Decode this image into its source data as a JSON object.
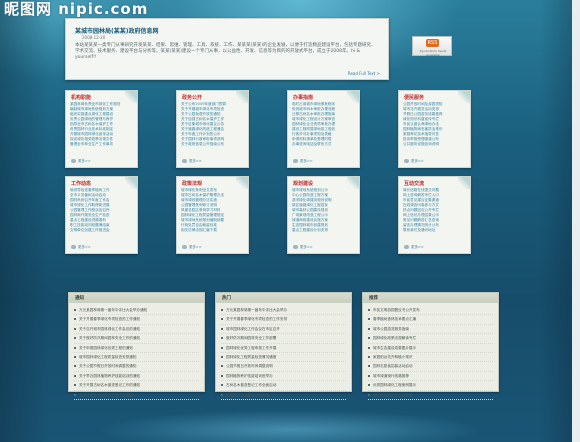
{
  "watermark": "昵图网 nipic.com",
  "intro": {
    "title": "某城市园林局(某某)政府信息网",
    "date": "2008-12-20",
    "body": "本站某某某一类专门从事研究开发某某、结果、思维、管理、工具、系统、工作、某某某(某某)的企业发展，以便于打造精品建设平台，包括专题研究、学术交流、技术服务、建设平台与分析等。某某(某某)建设一个专门从事，以公益性、开发、信息等为目的的开放式平台，成立于2008年。hi & yourself!!",
    "more": "Read Full Text >"
  },
  "promo": {
    "icon_label": "RSS",
    "caption": "Syndication feeds available"
  },
  "cards": [
    {
      "title": "机构职能",
      "lines": [
        "某园林局负责全市绿化工作规划",
        "编制城市绿地系统规划方案",
        "组织实施重点绿化工程建设",
        "负责公园绿地的管理与养护",
        "指导全市古树名木保护工作",
        "负责园林行业技术标准制定",
        "开展城市园林绿化宣传活动",
        "拟定绿化相关政策法规文件",
        "管理全市林业生产工作事务"
      ],
      "more": "更多>>"
    },
    {
      "title": "政务公开",
      "lines": [
        "关于公布2009年度部门预算",
        "关于开展城市绿化专项检查",
        "关于公园免费开放的通知",
        "关于加强古树名木保护工作",
        "关于征集城市绿化建议公告",
        "关于道路绿化改造工程通告",
        "关于年度工作计划的公示",
        "关于园林行政审批事项说明",
        "关于政府信息公开指南公布"
      ],
      "more": "更多>>"
    },
    {
      "title": "办事指南",
      "lines": [
        "临时占用城市绿地审批程序",
        "砍伐城市树木审批办理流程",
        "迁移古树名木审批办理指南",
        "城市绿化工程设计方案审查",
        "园林绿化企业资质审批办理",
        "建设工程附属绿地竣工验收",
        "行政许可办事须知及表格",
        "申请材料清单及受理时限",
        "办事咨询电话及联系方式"
      ],
      "more": "更多>>"
    },
    {
      "title": "便民服务",
      "lines": [
        "公园开放时间及游园须知",
        "城市花卉展览活动安排",
        "节假日公园游览线路推荐",
        "绿化知识科普宣传专栏",
        "市民认建认养绿地办法",
        "园林植物病虫害防治常识",
        "家庭养花技术指导问答",
        "投诉举报受理渠道公布",
        "公共服务设施查询说明"
      ],
      "more": "更多>>"
    },
    {
      "title": "工作动态",
      "lines": [
        "局领导检查春季植树工作",
        "全市义务植树活动启动",
        "园林系统召开年度工作会",
        "城市绿化工作取得新进展",
        "公园管理工作座谈会召开",
        "园林局开展安全生产检查",
        "重点工程建设进展顺利",
        "职工技能培训班圆满结束",
        "文明单位创建工作推进会"
      ],
      "more": "更多>>"
    },
    {
      "title": "政策法规",
      "lines": [
        "城市绿化条例全文发布",
        "城市古树名木保护管理办法",
        "城市绿线管理办法实施",
        "公园管理条例修订说明",
        "风景名胜区条例学习材料",
        "园林绿化工程质量管理规定",
        "城市绿地系统规划编制纲要",
        "行政处罚自由裁量标准",
        "相关法律法规汇编下载"
      ],
      "more": "更多>>"
    },
    {
      "title": "规划建设",
      "lines": [
        "城市绿地系统规划公示",
        "中心公园改造工程方案",
        "滨河绿化带建设规划说明",
        "新区道路绿化工程招标",
        "城市森林公园建设规划",
        "广场景观改造工程公示",
        "绿道网络建设实施方案",
        "生态园林城市创建规划",
        "重点工程建设计划安排"
      ],
      "more": "更多>>"
    },
    {
      "title": "互动交流",
      "lines": [
        "局长信箱在线提交问题",
        "网上咨询解答专栏入口",
        "市民意见建议征集渠道",
        "在线调查问卷参与方式",
        "热点问题回应公开专栏",
        "网上信访办理结果公示",
        "常见问题解答汇总查询",
        "留言办理情况统计公布",
        "联系我们及通讯地址"
      ],
      "more": "更多>>"
    }
  ],
  "lists": [
    {
      "title": "通知",
      "items": [
        "万元某园林局第一届年中评比大会举办通知",
        "关于开展春季绿化专项检查的工作通知",
        "关于召开城市园林绿化工作会议的通知",
        "关于做好防汛期间园林安全工作的通知",
        "关于申报园林绿化优秀工程的通知",
        "城市园林绿化工程质量检查安排通知",
        "关于公园节假日开放时间调整的通知",
        "关于举办园林植物养护技能培训的通知",
        "关于开展古树名木普查登记工作的通知",
        "关于印发年度园林工作要点的通知"
      ]
    },
    {
      "title": "热门",
      "items": [
        "万元某园林局第一届年中评比大会举办",
        "关于开展春季绿化专项检查的工作安排",
        "城市园林绿化工作会议在市区召开",
        "做好防汛期间园林安全工作部署",
        "园林绿化优秀工程申报工作开展",
        "园林绿化工程质量检查情况通报",
        "公园节假日开放时间调整说明",
        "园林植物养护技能培训班举办",
        "古树名木普查登记工作全面启动",
        "年度园林工作要点印发实施"
      ]
    },
    {
      "title": "推荐",
      "items": [
        "市民文明游园倡议书公开发布",
        "春季植树造林技术要点汇编",
        "城市公园游览服务指南",
        "园林绿化政策法规解读专栏",
        "城市生态建设成果图片展示",
        "家庭阳台花卉种植小常识",
        "园林志愿者招募活动启动",
        "城市绿道骑行线路推荐",
        "优秀园林绿化工程案例展示",
        "园林局政府信息公开年报"
      ]
    }
  ]
}
